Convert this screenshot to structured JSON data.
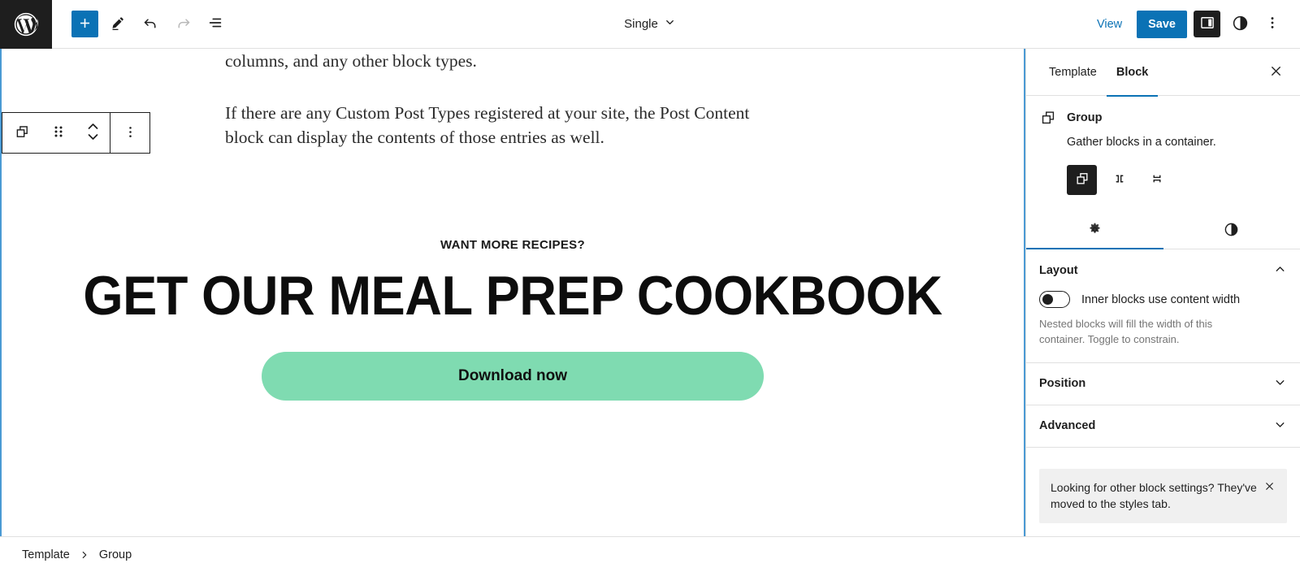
{
  "colors": {
    "accent_blue": "#0b72b5",
    "dark": "#1e1e1e",
    "cta_green": "#7fdbb1",
    "selection_outline": "#4a9ad4",
    "notice_bg": "#f0f0f0",
    "muted_text": "#757575"
  },
  "header": {
    "logo_label": "wordpress-logo",
    "tools": [
      {
        "name": "add-block-button",
        "label": "+"
      },
      {
        "name": "edit-mode-button",
        "label": "Edit"
      },
      {
        "name": "undo-button",
        "label": "Undo"
      },
      {
        "name": "redo-button",
        "label": "Redo"
      },
      {
        "name": "list-view-button",
        "label": "List View"
      }
    ],
    "document_title": "Single",
    "view_label": "View",
    "save_label": "Save",
    "settings_toggle_label": "Settings",
    "styles_toggle_label": "Styles",
    "more_options_label": "Options"
  },
  "block_toolbar": {
    "block_type_label": "Group",
    "drag_label": "Drag",
    "move_up_label": "Move up",
    "move_down_label": "Move down",
    "more_label": "Options"
  },
  "canvas": {
    "paragraphs": [
      "columns, and any other block types.",
      "If there are any Custom Post Types registered at your site, the Post Content block can display the contents of those entries as well."
    ],
    "cta": {
      "eyebrow": "WANT MORE RECIPES?",
      "heading": "GET OUR MEAL PREP COOKBOOK",
      "button_label": "Download now"
    }
  },
  "sidebar": {
    "tabs": [
      {
        "label": "Template",
        "active": false
      },
      {
        "label": "Block",
        "active": true
      }
    ],
    "close_label": "Close Settings",
    "block_card": {
      "icon": "group-icon",
      "title": "Group",
      "description": "Gather blocks in a container."
    },
    "variations": [
      {
        "name": "variation-group",
        "label": "Group",
        "active": true
      },
      {
        "name": "variation-row",
        "label": "Row",
        "active": false
      },
      {
        "name": "variation-stack",
        "label": "Stack",
        "active": false
      }
    ],
    "subtabs": [
      {
        "name": "tab-settings",
        "icon": "gear-icon",
        "label": "Settings",
        "active": true
      },
      {
        "name": "tab-styles",
        "icon": "contrast-icon",
        "label": "Styles",
        "active": false
      }
    ],
    "panels": [
      {
        "name": "layout",
        "title": "Layout",
        "expanded": true,
        "toggle_label": "Inner blocks use content width",
        "toggle_on": false,
        "help": "Nested blocks will fill the width of this container. Toggle to constrain."
      },
      {
        "name": "position",
        "title": "Position",
        "expanded": false
      },
      {
        "name": "advanced",
        "title": "Advanced",
        "expanded": false
      }
    ],
    "notice": {
      "text": "Looking for other block settings? They've moved to the styles tab.",
      "close_label": "Dismiss"
    }
  },
  "footer": {
    "breadcrumb": [
      {
        "label": "Template"
      },
      {
        "label": "Group"
      }
    ]
  }
}
